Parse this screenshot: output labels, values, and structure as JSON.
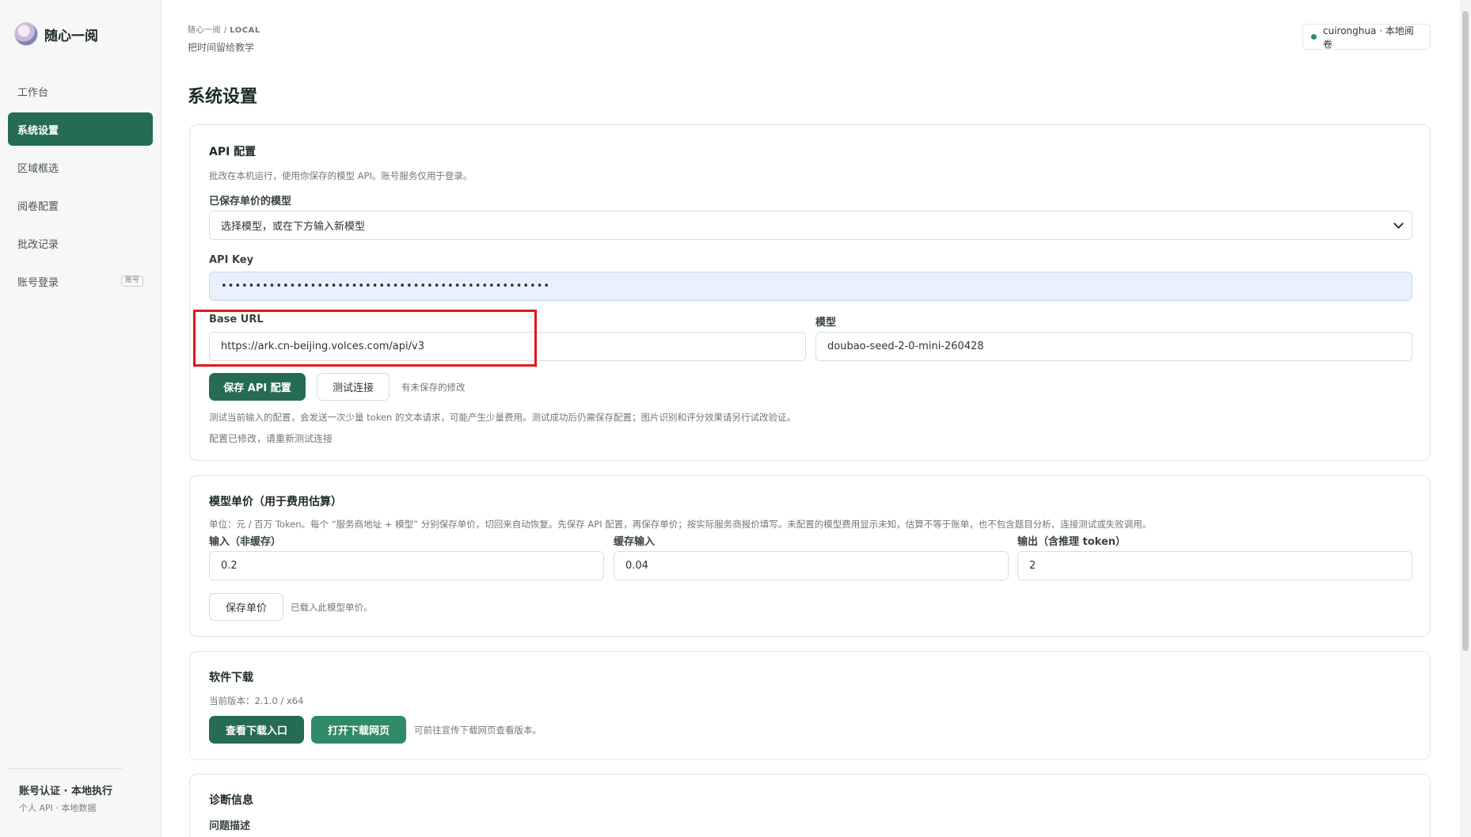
{
  "app": {
    "name": "随心一阅"
  },
  "sidebar": {
    "items": [
      {
        "label": "工作台"
      },
      {
        "label": "系统设置"
      },
      {
        "label": "区域框选"
      },
      {
        "label": "阅卷配置"
      },
      {
        "label": "批改记录"
      },
      {
        "label": "账号登录",
        "badge": "账号"
      }
    ],
    "footer_title": "账号认证 · 本地执行",
    "footer_sub": "个人 API · 本地数据"
  },
  "header": {
    "breadcrumb_app": "随心一阅",
    "breadcrumb_sep": "/",
    "breadcrumb_mode": "LOCAL",
    "subtitle": "把时间留给教学",
    "user": "cuironghua · 本地阅卷"
  },
  "page": {
    "title": "系统设置"
  },
  "api_config": {
    "title": "API 配置",
    "desc": "批改在本机运行，使用你保存的模型 API。账号服务仅用于登录。",
    "saved_models_label": "已保存单价的模型",
    "saved_models_value": "选择模型，或在下方输入新模型",
    "api_key_label": "API Key",
    "api_key_value": "••••••••••••••••••••••••••••••••••••••••••••••••",
    "base_url_label": "Base URL",
    "base_url_value": "https://ark.cn-beijing.volces.com/api/v3",
    "model_label": "模型",
    "model_value": "doubao-seed-2-0-mini-260428",
    "save_button": "保存 API 配置",
    "test_button": "测试连接",
    "unsaved_note": "有未保存的修改",
    "test_note": "测试当前输入的配置，会发送一次少量 token 的文本请求，可能产生少量费用。测试成功后仍需保存配置；图片识别和评分效果请另行试改验证。",
    "modified_note": "配置已修改，请重新测试连接"
  },
  "pricing": {
    "title": "模型单价（用于费用估算）",
    "desc": "单位：元 / 百万 Token。每个 “服务商地址 + 模型” 分别保存单价，切回来自动恢复。先保存 API 配置，再保存单价；按实际服务商报价填写。未配置的模型费用显示未知，估算不等于账单，也不包含题目分析、连接测试或失败调用。",
    "input_label": "输入（非缓存）",
    "input_value": "0.2",
    "cached_label": "缓存输入",
    "cached_value": "0.04",
    "output_label": "输出（含推理 token）",
    "output_value": "2",
    "save_button": "保存单价",
    "loaded_note": "已载入此模型单价。"
  },
  "download": {
    "title": "软件下载",
    "version": "当前版本：2.1.0 / x64",
    "view_button": "查看下载入口",
    "open_button": "打开下载网页",
    "note": "可前往宣传下载网页查看版本。"
  },
  "diagnostics": {
    "title": "诊断信息",
    "problem_label": "问题描述"
  },
  "colors": {
    "primary": "#256b55",
    "primary_alt": "#2f8a67",
    "highlight": "#e01919"
  }
}
